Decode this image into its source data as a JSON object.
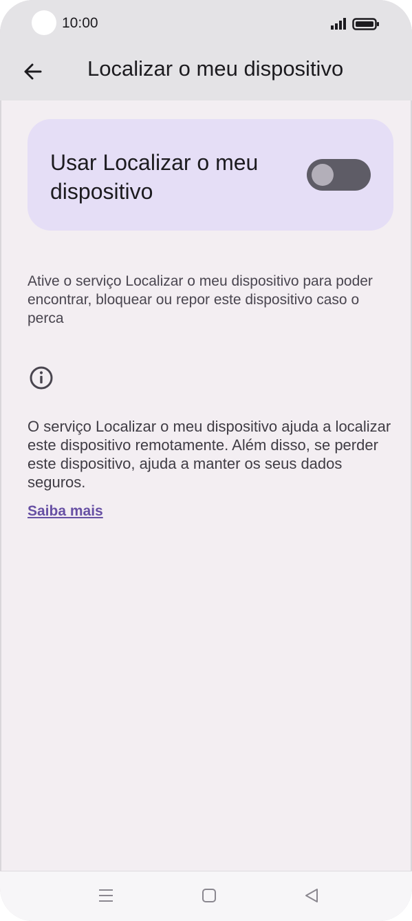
{
  "status_bar": {
    "time": "10:00",
    "icons": [
      "signal-icon",
      "battery-icon"
    ]
  },
  "app_bar": {
    "back_icon": "arrow-left-icon",
    "title": "Localizar o meu dispositivo"
  },
  "toggle_card": {
    "label": "Usar Localizar o meu dispositivo",
    "enabled": false
  },
  "description": "Ative o serviço Localizar o meu dispositivo para poder encontrar, bloquear ou repor este dispositivo caso o perca",
  "info": {
    "icon": "info-icon",
    "text": "O serviço Localizar o meu dispositivo ajuda a localizar este dispositivo remotamente. Além disso, se perder este dispositivo, ajuda a manter os seus dados seguros.",
    "link_label": "Saiba mais"
  },
  "nav_bar": {
    "icons": [
      "menu-icon",
      "home-icon",
      "back-triangle-icon"
    ]
  },
  "colors": {
    "background": "#f3eef2",
    "app_bar": "#e4e3e6",
    "card": "#e5def6",
    "switch_track_off": "#5e5c66",
    "link": "#6750a4"
  }
}
